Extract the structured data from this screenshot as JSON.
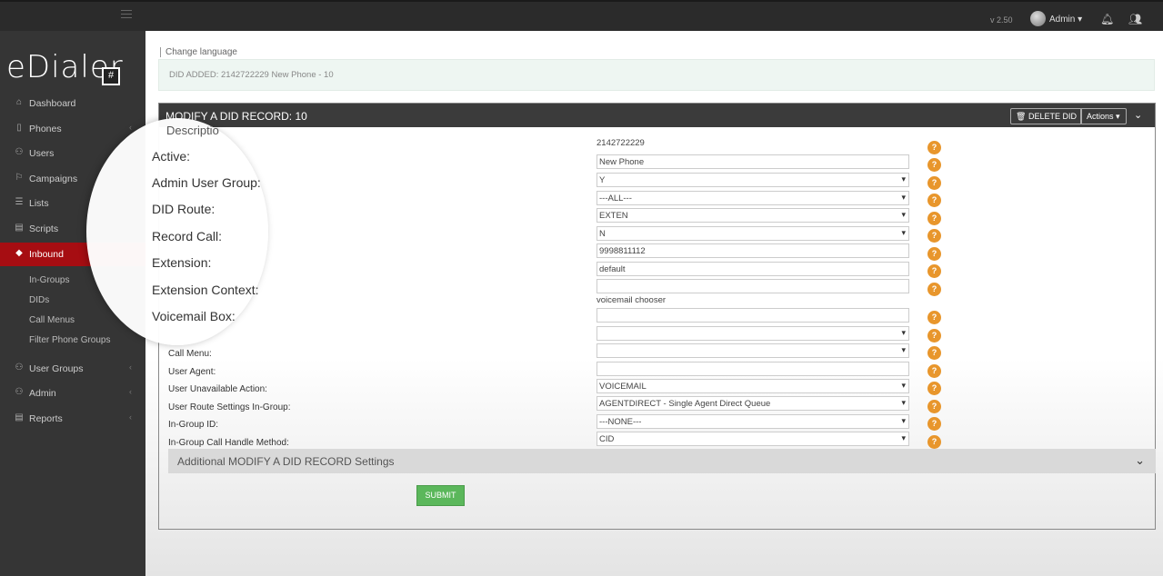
{
  "topbar": {
    "version": "v 2.50",
    "user": "Admin"
  },
  "sidebar": {
    "logo": "eDialer",
    "logo_box": "#",
    "items": [
      {
        "label": "Dashboard",
        "icon": "home-icon"
      },
      {
        "label": "Phones",
        "icon": "phone-icon"
      },
      {
        "label": "Users",
        "icon": "users-icon"
      },
      {
        "label": "Campaigns",
        "icon": "flag-icon"
      },
      {
        "label": "Lists",
        "icon": "list-icon"
      },
      {
        "label": "Scripts",
        "icon": "document-icon"
      },
      {
        "label": "Inbound",
        "icon": "diamond-icon"
      },
      {
        "label": "User Groups",
        "icon": "user-group-icon"
      },
      {
        "label": "Admin",
        "icon": "admin-icon"
      },
      {
        "label": "Reports",
        "icon": "report-icon"
      }
    ],
    "sub_items": [
      "In-Groups",
      "DIDs",
      "Call Menus",
      "Filter Phone Groups"
    ]
  },
  "main": {
    "change_language": "Change language",
    "alert": "DID ADDED: 2142722229 New Phone - 10",
    "panel_title": "MODIFY A DID RECORD: 10",
    "delete_label": "DELETE DID",
    "actions_label": "Actions",
    "description_label": "Descriptio",
    "zoom_labels": [
      "Active:",
      "Admin User Group:",
      "DID Route:",
      "Record Call:",
      "Extension:",
      "Extension Context:",
      "Voicemail Box:"
    ],
    "labels": [
      "Call Menu:",
      "User Agent:",
      "User Unavailable Action:",
      "User Route Settings In-Group:",
      "In-Group ID:",
      "In-Group Call Handle Method:"
    ],
    "did_value": "2142722229",
    "fields": {
      "description": "New Phone",
      "active": "Y",
      "admin_group": "---ALL---",
      "did_route": "EXTEN",
      "record_call": "N",
      "extension": "9998811112",
      "extension_context": "default",
      "voicemail_box": "",
      "voicemail_chooser": "voicemail chooser",
      "voicemail_input": "",
      "call_menu_select": "",
      "call_menu": "",
      "user_agent": "",
      "user_unavailable_action": "VOICEMAIL",
      "user_route_settings": "AGENTDIRECT - Single Agent Direct Queue",
      "ingroup_id": "---NONE---",
      "ingroup_handle": "CID"
    },
    "additional_label": "Additional MODIFY A DID RECORD Settings",
    "submit_label": "SUBMIT",
    "help_glyph": "?"
  }
}
